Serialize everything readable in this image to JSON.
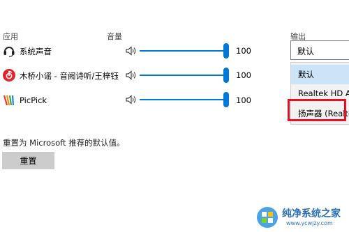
{
  "headers": {
    "apps": "应用",
    "volume": "音量",
    "output": "输出"
  },
  "apps": [
    {
      "name": "系统声音",
      "icon": "headset-icon",
      "volume": 100
    },
    {
      "name": "木桥小谣 - 音阙诗听/王梓钰",
      "icon": "netease-music-icon",
      "volume": 100
    },
    {
      "name": "PicPick",
      "icon": "picpick-icon",
      "volume": 100
    }
  ],
  "output": {
    "selected": "默认",
    "options": [
      "默认",
      "Realtek HD Au",
      "扬声器 (Realte"
    ]
  },
  "reset": {
    "description": "重置为 Microsoft 推荐的默认值。",
    "button_label": "重置"
  },
  "watermark": {
    "title": "纯净系统之家",
    "url": "www.ycwjzy.com"
  },
  "colors": {
    "accent": "#0078d7",
    "highlight": "#e81123"
  }
}
